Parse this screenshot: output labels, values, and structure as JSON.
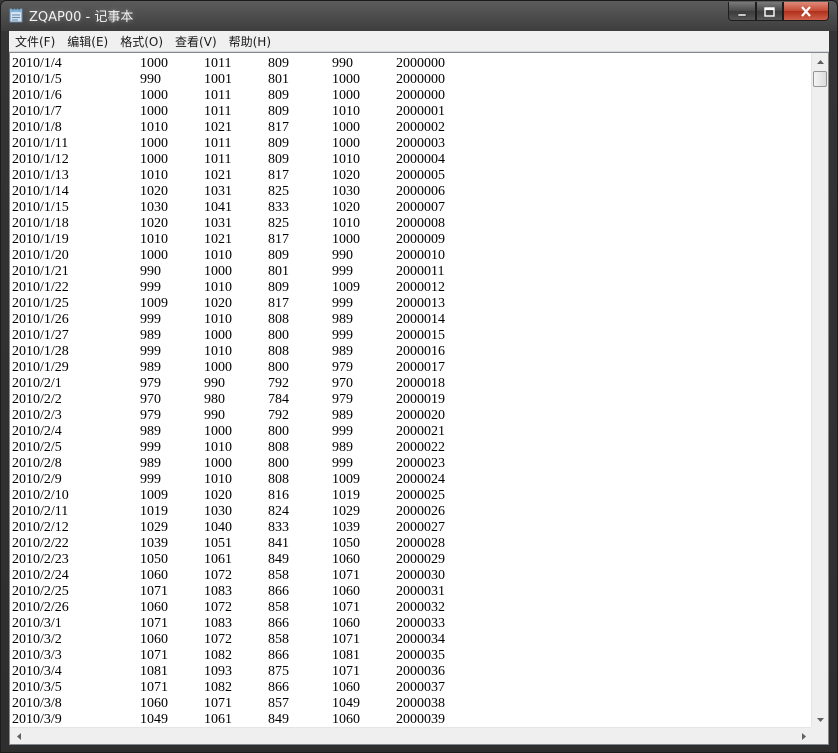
{
  "window": {
    "title": "ZQAP00 - 记事本",
    "icon": "notepad-icon"
  },
  "controls": {
    "minimize": "minimize-icon",
    "maximize": "maximize-icon",
    "close": "close-icon"
  },
  "menu": {
    "items": [
      "文件(F)",
      "编辑(E)",
      "格式(O)",
      "查看(V)",
      "帮助(H)"
    ]
  },
  "document": {
    "rows": [
      [
        "2010/1/4",
        "1000",
        "1011",
        "809",
        "990",
        "2000000"
      ],
      [
        "2010/1/5",
        "990",
        "1001",
        "801",
        "1000",
        "2000000"
      ],
      [
        "2010/1/6",
        "1000",
        "1011",
        "809",
        "1000",
        "2000000"
      ],
      [
        "2010/1/7",
        "1000",
        "1011",
        "809",
        "1010",
        "2000001"
      ],
      [
        "2010/1/8",
        "1010",
        "1021",
        "817",
        "1000",
        "2000002"
      ],
      [
        "2010/1/11",
        "1000",
        "1011",
        "809",
        "1000",
        "2000003"
      ],
      [
        "2010/1/12",
        "1000",
        "1011",
        "809",
        "1010",
        "2000004"
      ],
      [
        "2010/1/13",
        "1010",
        "1021",
        "817",
        "1020",
        "2000005"
      ],
      [
        "2010/1/14",
        "1020",
        "1031",
        "825",
        "1030",
        "2000006"
      ],
      [
        "2010/1/15",
        "1030",
        "1041",
        "833",
        "1020",
        "2000007"
      ],
      [
        "2010/1/18",
        "1020",
        "1031",
        "825",
        "1010",
        "2000008"
      ],
      [
        "2010/1/19",
        "1010",
        "1021",
        "817",
        "1000",
        "2000009"
      ],
      [
        "2010/1/20",
        "1000",
        "1010",
        "809",
        "990",
        "2000010"
      ],
      [
        "2010/1/21",
        "990",
        "1000",
        "801",
        "999",
        "2000011"
      ],
      [
        "2010/1/22",
        "999",
        "1010",
        "809",
        "1009",
        "2000012"
      ],
      [
        "2010/1/25",
        "1009",
        "1020",
        "817",
        "999",
        "2000013"
      ],
      [
        "2010/1/26",
        "999",
        "1010",
        "808",
        "989",
        "2000014"
      ],
      [
        "2010/1/27",
        "989",
        "1000",
        "800",
        "999",
        "2000015"
      ],
      [
        "2010/1/28",
        "999",
        "1010",
        "808",
        "989",
        "2000016"
      ],
      [
        "2010/1/29",
        "989",
        "1000",
        "800",
        "979",
        "2000017"
      ],
      [
        "2010/2/1",
        "979",
        "990",
        "792",
        "970",
        "2000018"
      ],
      [
        "2010/2/2",
        "970",
        "980",
        "784",
        "979",
        "2000019"
      ],
      [
        "2010/2/3",
        "979",
        "990",
        "792",
        "989",
        "2000020"
      ],
      [
        "2010/2/4",
        "989",
        "1000",
        "800",
        "999",
        "2000021"
      ],
      [
        "2010/2/5",
        "999",
        "1010",
        "808",
        "989",
        "2000022"
      ],
      [
        "2010/2/8",
        "989",
        "1000",
        "800",
        "999",
        "2000023"
      ],
      [
        "2010/2/9",
        "999",
        "1010",
        "808",
        "1009",
        "2000024"
      ],
      [
        "2010/2/10",
        "1009",
        "1020",
        "816",
        "1019",
        "2000025"
      ],
      [
        "2010/2/11",
        "1019",
        "1030",
        "824",
        "1029",
        "2000026"
      ],
      [
        "2010/2/12",
        "1029",
        "1040",
        "833",
        "1039",
        "2000027"
      ],
      [
        "2010/2/22",
        "1039",
        "1051",
        "841",
        "1050",
        "2000028"
      ],
      [
        "2010/2/23",
        "1050",
        "1061",
        "849",
        "1060",
        "2000029"
      ],
      [
        "2010/2/24",
        "1060",
        "1072",
        "858",
        "1071",
        "2000030"
      ],
      [
        "2010/2/25",
        "1071",
        "1083",
        "866",
        "1060",
        "2000031"
      ],
      [
        "2010/2/26",
        "1060",
        "1072",
        "858",
        "1071",
        "2000032"
      ],
      [
        "2010/3/1",
        "1071",
        "1083",
        "866",
        "1060",
        "2000033"
      ],
      [
        "2010/3/2",
        "1060",
        "1072",
        "858",
        "1071",
        "2000034"
      ],
      [
        "2010/3/3",
        "1071",
        "1082",
        "866",
        "1081",
        "2000035"
      ],
      [
        "2010/3/4",
        "1081",
        "1093",
        "875",
        "1071",
        "2000036"
      ],
      [
        "2010/3/5",
        "1071",
        "1082",
        "866",
        "1060",
        "2000037"
      ],
      [
        "2010/3/8",
        "1060",
        "1071",
        "857",
        "1049",
        "2000038"
      ],
      [
        "2010/3/9",
        "1049",
        "1061",
        "849",
        "1060",
        "2000039"
      ]
    ]
  },
  "scrollbars": {
    "up": "scroll-up-arrow-icon",
    "down": "scroll-down-arrow-icon",
    "left": "scroll-left-arrow-icon",
    "right": "scroll-right-arrow-icon"
  }
}
